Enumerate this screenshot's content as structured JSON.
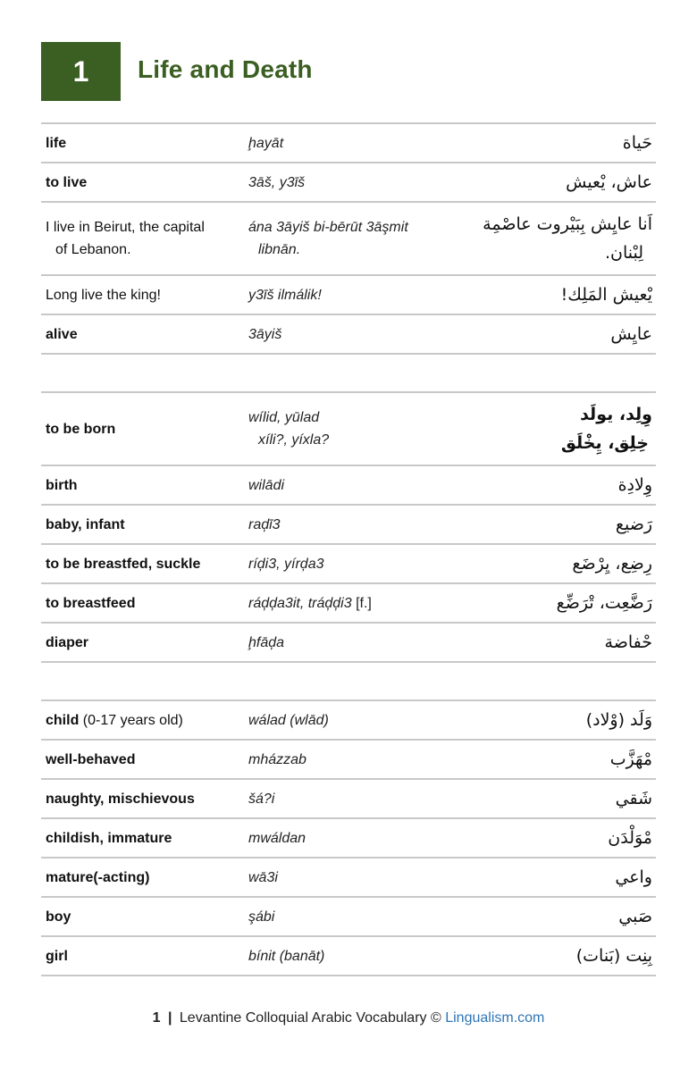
{
  "chapter": {
    "number": "1",
    "title": "Life and Death",
    "accent_color": "#3b5e22"
  },
  "sections": [
    {
      "rows": [
        {
          "english": "life",
          "english_bold": true,
          "transliteration": "ḩayāt",
          "arabic": "حَياة"
        },
        {
          "english": "to live",
          "english_bold": true,
          "transliteration": "3āš, y3īš",
          "arabic": "عاش، يْعيش"
        },
        {
          "english_line1": "I live in Beirut, the capital",
          "english_line2": "of Lebanon.",
          "english_bold": false,
          "transliteration_line1": "ána 3āyiš bi-bērūt 3āşmit",
          "transliteration_line2": "libnān.",
          "arabic_line1": "اَنا عايِش بِبَيْروت عاصْمِة",
          "arabic_line2": "لِبْنان."
        },
        {
          "english": "Long live the king!",
          "english_bold": false,
          "transliteration": "y3īš ilmálik!",
          "arabic": "يْعيش المَلِك!"
        },
        {
          "english": "alive",
          "english_bold": true,
          "transliteration": "3āyiš",
          "arabic": "عايِش"
        }
      ]
    },
    {
      "rows": [
        {
          "english": "to be born",
          "english_bold": true,
          "transliteration_line1": "wílid, yūlad",
          "transliteration_line2": "xíli?, yíxla?",
          "arabic_line1": "وِلِد، يولَد",
          "arabic_line2": "خِلِق، يِخْلَق"
        },
        {
          "english": "birth",
          "english_bold": true,
          "transliteration": "wilādi",
          "arabic": "وِلادِة"
        },
        {
          "english": "baby, infant",
          "english_bold": true,
          "transliteration": "raḑī3",
          "arabic": "رَضيع"
        },
        {
          "english": "to be breastfed, suckle",
          "english_bold": true,
          "transliteration": "ríḑi3, yírḑa3",
          "arabic": "رِضِع، يِرْضَع"
        },
        {
          "english": "to breastfeed",
          "english_bold": true,
          "transliteration": "ráḑḑa3it, tráḑḑi3",
          "transliteration_note": "[f.]",
          "arabic": "رَضَّعِت، تْرَضِّع"
        },
        {
          "english": "diaper",
          "english_bold": true,
          "transliteration": "ḩfāḑa",
          "arabic": "حْفاضة"
        }
      ]
    },
    {
      "rows": [
        {
          "english": "child",
          "english_note": "(0-17 years old)",
          "english_bold": true,
          "transliteration": "wálad (wlād)",
          "arabic": "وَلَد (وْلاد)"
        },
        {
          "english": "well-behaved",
          "english_bold": true,
          "transliteration": "mházzab",
          "arabic": "مْهَزَّب"
        },
        {
          "english": "naughty, mischievous",
          "english_bold": true,
          "transliteration": "šá?i",
          "arabic": "شَقي"
        },
        {
          "english": "childish, immature",
          "english_bold": true,
          "transliteration": "mwáldan",
          "arabic": "مْوَلْدَن"
        },
        {
          "english": "mature(-acting)",
          "english_bold": true,
          "transliteration": "wā3i",
          "arabic": "واعي"
        },
        {
          "english": "boy",
          "english_bold": true,
          "transliteration": "şábi",
          "arabic": "صَبي"
        },
        {
          "english": "girl",
          "english_bold": true,
          "transliteration": "bínit (banāt)",
          "arabic": "بِنِت (بَنات)"
        }
      ]
    }
  ],
  "footer": {
    "page_number": "1",
    "separator": "|",
    "text": "Levantine Colloquial Arabic Vocabulary ©",
    "link": "Lingualism.com",
    "link_color": "#2e75b6"
  }
}
